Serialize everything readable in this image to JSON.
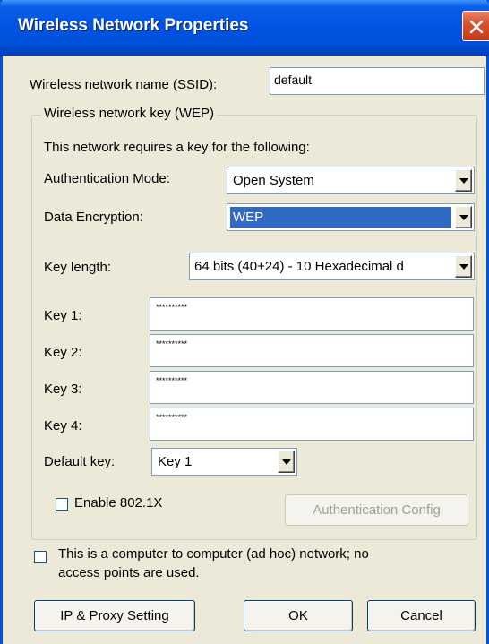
{
  "window": {
    "title": "Wireless Network Properties"
  },
  "ssid": {
    "label": "Wireless network name (SSID):",
    "value": "default"
  },
  "wep_group": {
    "legend": "Wireless network key (WEP)",
    "intro": "This network requires a key for the following:",
    "auth_mode": {
      "label": "Authentication Mode:",
      "value": "Open System"
    },
    "data_encryption": {
      "label": "Data Encryption:",
      "value": "WEP"
    },
    "key_length": {
      "label": "Key length:",
      "value": "64 bits (40+24) - 10 Hexadecimal d"
    },
    "keys": [
      {
        "label": "Key 1:",
        "value": "**********"
      },
      {
        "label": "Key 2:",
        "value": "**********"
      },
      {
        "label": "Key 3:",
        "value": "**********"
      },
      {
        "label": "Key 4:",
        "value": "**********"
      }
    ],
    "default_key": {
      "label": "Default key:",
      "value": "Key 1"
    },
    "enable_8021x": {
      "label": "Enable 802.1X",
      "checked": false
    },
    "auth_config_button": "Authentication Config"
  },
  "adhoc": {
    "label_line1": "This is a computer to computer (ad hoc) network; no",
    "label_line2": "access points are used.",
    "checked": false
  },
  "buttons": {
    "ip_proxy": "IP & Proxy Setting",
    "ok": "OK",
    "cancel": "Cancel"
  },
  "icons": {
    "close": "close-icon",
    "dropdown": "chevron-down-icon"
  },
  "colors": {
    "titlebar": "#0054e3",
    "close_button": "#d8532d",
    "selection": "#316ac5",
    "dialog_bg": "#ece9d8"
  }
}
